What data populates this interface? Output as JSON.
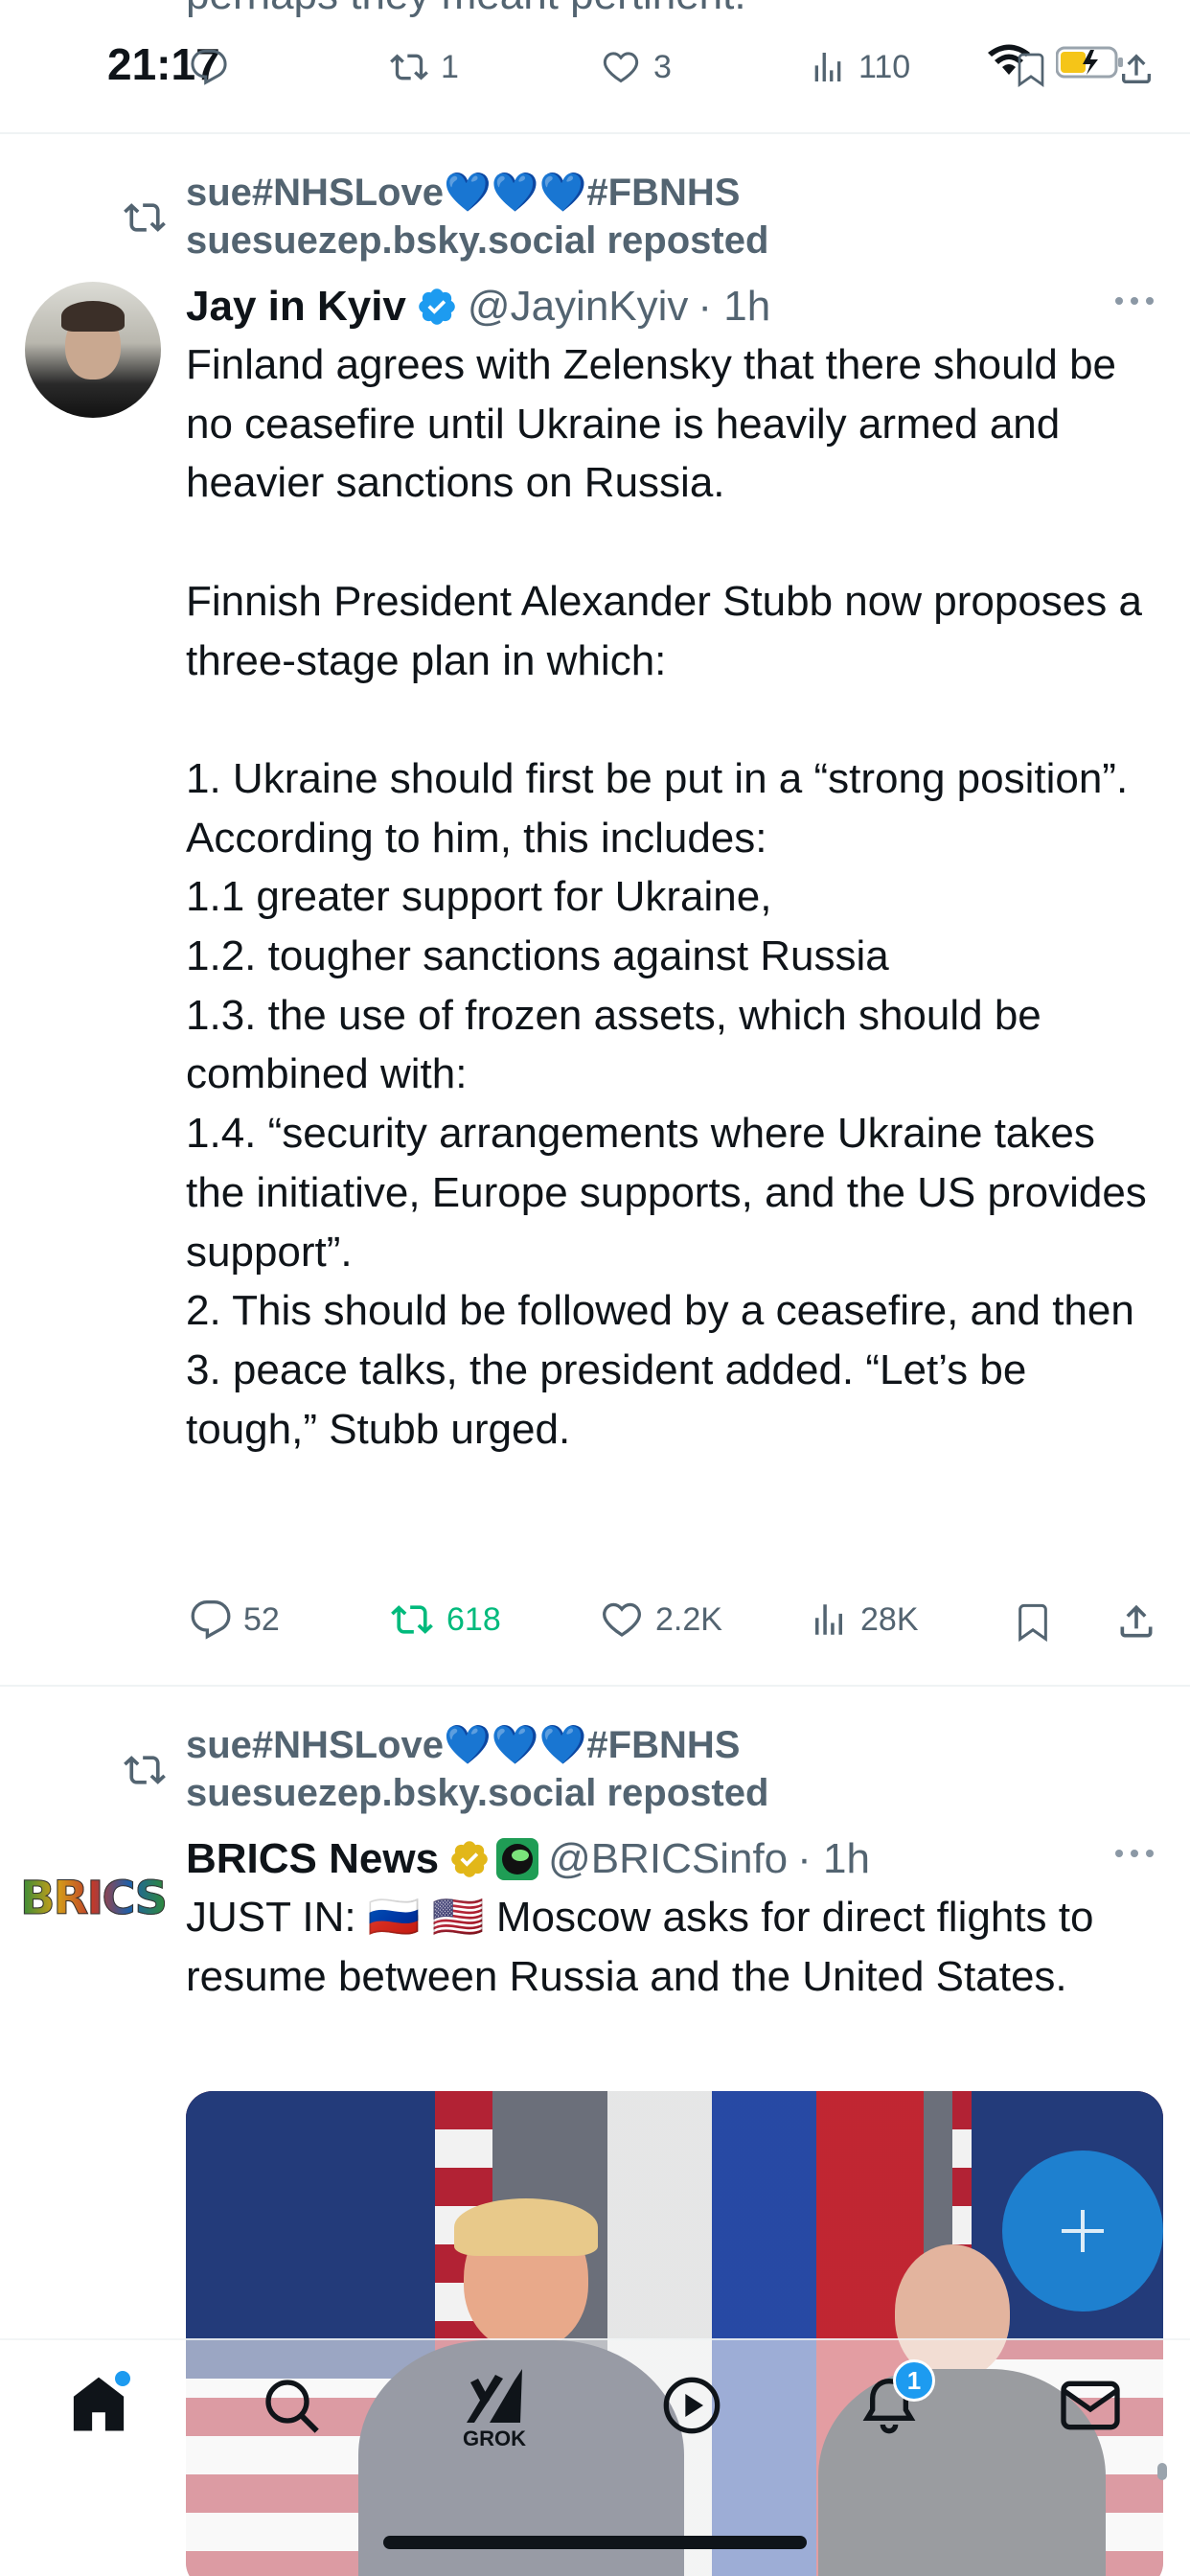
{
  "status_bar": {
    "time": "21:17"
  },
  "top_partial": {
    "cut_text": "perhaps they meant pertinent.",
    "retweets": "1",
    "likes": "3",
    "views": "110"
  },
  "tweet1": {
    "repost_line1": "sue#NHSLove💙💙💙#FBNHS",
    "repost_line2": "suesuezep.bsky.social reposted",
    "name": "Jay in Kyiv",
    "handle": "@JayinKyiv",
    "time": "· 1h",
    "text": "Finland agrees with Zelensky that there should be no ceasefire until Ukraine is heavily armed and heavier sanctions on Russia.\n\nFinnish President Alexander Stubb now proposes a three-stage plan in which:\n\n1. Ukraine should first be put in a “strong position”.\nAccording to him, this includes:\n1.1 greater support for Ukraine,\n1.2. tougher sanctions against Russia\n1.3. the use of frozen assets, which should be combined with:\n1.4. “security arrangements where Ukraine takes the initiative, Europe supports, and the US provides support”.\n2. This should be followed by a ceasefire, and then\n3. peace talks, the president added. “Let’s be tough,” Stubb urged.",
    "replies": "52",
    "retweets": "618",
    "likes": "2.2K",
    "views": "28K"
  },
  "tweet2": {
    "repost_line1": "sue#NHSLove💙💙💙#FBNHS",
    "repost_line2": "suesuezep.bsky.social reposted",
    "avatar_text": "BRICS",
    "name": "BRICS News",
    "handle": "@BRICSinfo",
    "time": "· 1h",
    "text": "JUST IN: 🇷🇺 🇺🇸 Moscow asks for direct flights to resume between Russia and the United States."
  },
  "nav": {
    "grok_label": "GROK",
    "notification_count": "1"
  },
  "colors": {
    "accent": "#1d9bf0",
    "retweet_green": "#00ba7c",
    "gray": "#536471",
    "gold": "#e2b719"
  },
  "icons": [
    "reply-icon",
    "retweet-icon",
    "heart-icon",
    "views-icon",
    "bookmark-icon",
    "share-icon",
    "home-icon",
    "search-icon",
    "grok-icon",
    "video-icon",
    "bell-icon",
    "mail-icon",
    "compose-plus-icon",
    "verified-badge-icon",
    "more-icon"
  ]
}
